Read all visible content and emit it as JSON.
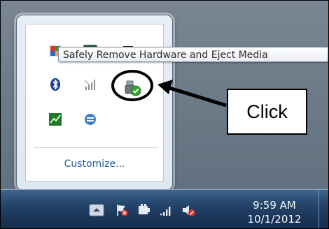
{
  "tooltip": {
    "text": "Safely Remove Hardware and Eject Media"
  },
  "flyout": {
    "customize_label": "Customize...",
    "icons": [
      "flag-icon",
      "monitor-icon",
      "chip-icon",
      "bluetooth-icon",
      "network-icon",
      "usb-eject-icon",
      "chart-icon",
      "sync-icon"
    ]
  },
  "annotation": {
    "callout_text": "Click",
    "color": "#000000"
  },
  "taskbar": {
    "time": "9:59 AM",
    "date": "10/1/2012",
    "tray_icons": [
      "show-hidden-icons-arrow-icon",
      "action-center-flag-icon",
      "power-icon",
      "network-signal-icon",
      "volume-muted-icon"
    ]
  },
  "colors": {
    "link": "#1f5fa8",
    "taskbar": "#1b3558",
    "accent_green": "#2fa52a"
  }
}
